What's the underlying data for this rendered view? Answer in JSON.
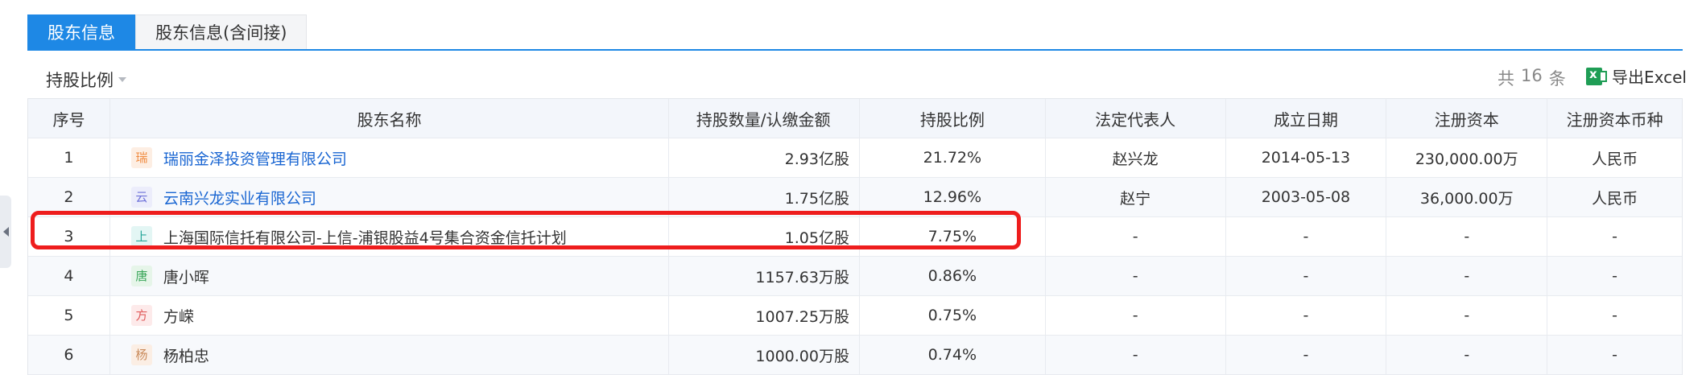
{
  "tabs": [
    {
      "label": "股东信息"
    },
    {
      "label": "股东信息(含间接)"
    }
  ],
  "toolbar": {
    "filter_label": "持股比例",
    "count_prefix": "共",
    "count_value": "16",
    "count_suffix": "条",
    "export_label": "导出Excel"
  },
  "table": {
    "columns": [
      "序号",
      "股东名称",
      "持股数量/认缴金额",
      "持股比例",
      "法定代表人",
      "成立日期",
      "注册资本",
      "注册资本币种"
    ],
    "rows": [
      {
        "no": "1",
        "badge": "瑞",
        "name": "瑞丽金泽投资管理有限公司",
        "shares": "2.93亿股",
        "ratio": "21.72%",
        "legal_rep": "赵兴龙",
        "date": "2014-05-13",
        "capital": "230,000.00万",
        "currency": "人民币"
      },
      {
        "no": "2",
        "badge": "云",
        "name": "云南兴龙实业有限公司",
        "shares": "1.75亿股",
        "ratio": "12.96%",
        "legal_rep": "赵宁",
        "date": "2003-05-08",
        "capital": "36,000.00万",
        "currency": "人民币"
      },
      {
        "no": "3",
        "badge": "上",
        "name": "上海国际信托有限公司-上信-浦银股益4号集合资金信托计划",
        "shares": "1.05亿股",
        "ratio": "7.75%",
        "legal_rep": "-",
        "date": "-",
        "capital": "-",
        "currency": "-"
      },
      {
        "no": "4",
        "badge": "唐",
        "name": "唐小晖",
        "shares": "1157.63万股",
        "ratio": "0.86%",
        "legal_rep": "-",
        "date": "-",
        "capital": "-",
        "currency": "-"
      },
      {
        "no": "5",
        "badge": "方",
        "name": "方嵘",
        "shares": "1007.25万股",
        "ratio": "0.75%",
        "legal_rep": "-",
        "date": "-",
        "capital": "-",
        "currency": "-"
      },
      {
        "no": "6",
        "badge": "杨",
        "name": "杨柏忠",
        "shares": "1000.00万股",
        "ratio": "0.74%",
        "legal_rep": "-",
        "date": "-",
        "capital": "-",
        "currency": "-"
      }
    ]
  },
  "colors": {
    "accent": "#1e88e5",
    "link": "#1a66d2",
    "highlight_box": "#ee1d1d",
    "excel_icon": "#1f9d55"
  }
}
